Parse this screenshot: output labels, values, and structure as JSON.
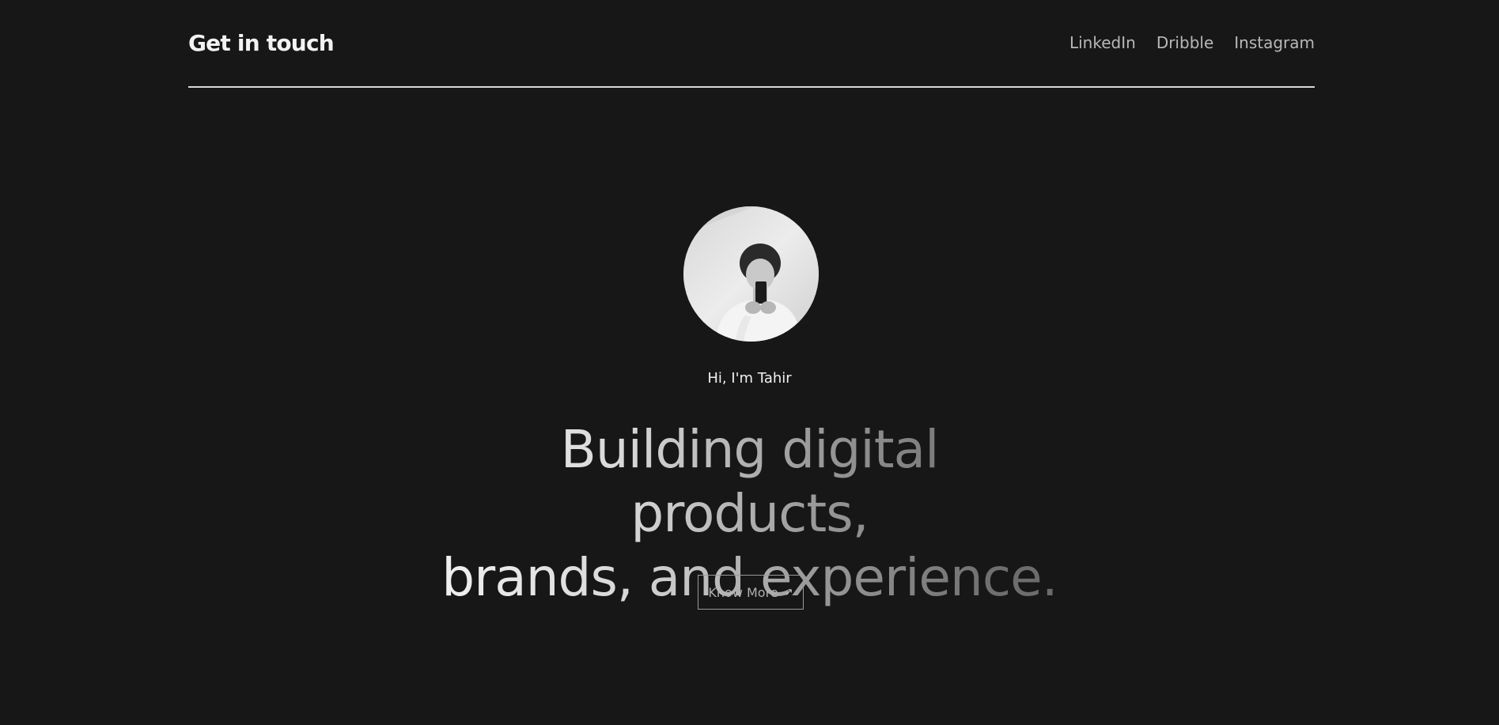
{
  "header": {
    "brand": "Get in touch",
    "nav": [
      "LinkedIn",
      "Dribble",
      "Instagram"
    ]
  },
  "hero": {
    "greeting": "Hi, I'm Tahir",
    "headline": {
      "line1": "Building digital products,",
      "line2": "brands, and experience."
    },
    "cta": {
      "label": "Know More",
      "icon": "arrow-up-right-icon"
    },
    "avatar": {
      "icon": "profile-photo"
    }
  },
  "colors": {
    "background": "#171717",
    "text": "#f2f2f2",
    "muted": "#b8b8b8",
    "divider": "#d9d9d9"
  }
}
